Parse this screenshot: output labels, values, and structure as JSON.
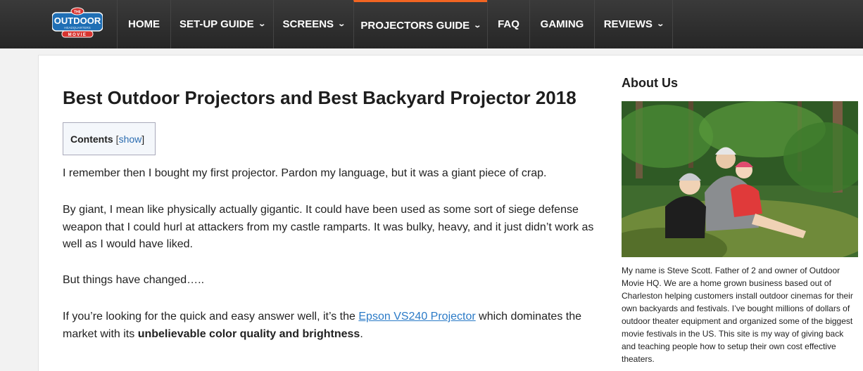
{
  "logo": {
    "top": "THE",
    "main": "OUTDOOR",
    "sub": "HEADQUARTERS",
    "bottom": "MOVIE"
  },
  "nav": {
    "items": [
      {
        "label": "HOME"
      },
      {
        "label": "SET-UP GUIDE"
      },
      {
        "label": "SCREENS"
      },
      {
        "label": "PROJECTORS GUIDE"
      },
      {
        "label": "FAQ"
      },
      {
        "label": "GAMING"
      },
      {
        "label": "REVIEWS"
      }
    ],
    "chevron": "⌄"
  },
  "article": {
    "title": "Best Outdoor Projectors and Best Backyard Projector 2018",
    "toc": {
      "label": "Contents",
      "bracket_open": "[",
      "toggle": "show",
      "bracket_close": "]"
    },
    "p1": "I remember then I bought my first projector. Pardon my language, but it was a giant piece of crap.",
    "p2": "By giant, I mean like physically actually gigantic. It could have been used as some sort of siege defense weapon that I could hurl at attackers from my castle ramparts. It was bulky, heavy, and it just didn’t work as well as I would have liked.",
    "p3": "But things have changed…..",
    "p4": {
      "before": "If you’re looking for the quick and easy answer well, it’s the ",
      "link": "Epson VS240 Projector",
      "middle": " which dominates the market with its ",
      "bold": "unbelievable color quality and brightness",
      "after": "."
    }
  },
  "sidebar": {
    "title": "About Us",
    "text": "My name is Steve Scott. Father of 2 and owner of Outdoor Movie HQ. We are a home grown business based out of Charleston helping customers install outdoor cinemas for their own backyards and festivals. I’ve bought millions of dollars of outdoor theater equipment and organized some of the biggest movie festivals in the US. This site is my way of giving back and teaching people how to setup their own cost effective theaters."
  },
  "colors": {
    "nav_bg": "#2d2d2d",
    "nav_active": "#f26522",
    "link": "#2a7ac7",
    "logo_blue": "#1f6fb5",
    "logo_red": "#d6332f"
  }
}
